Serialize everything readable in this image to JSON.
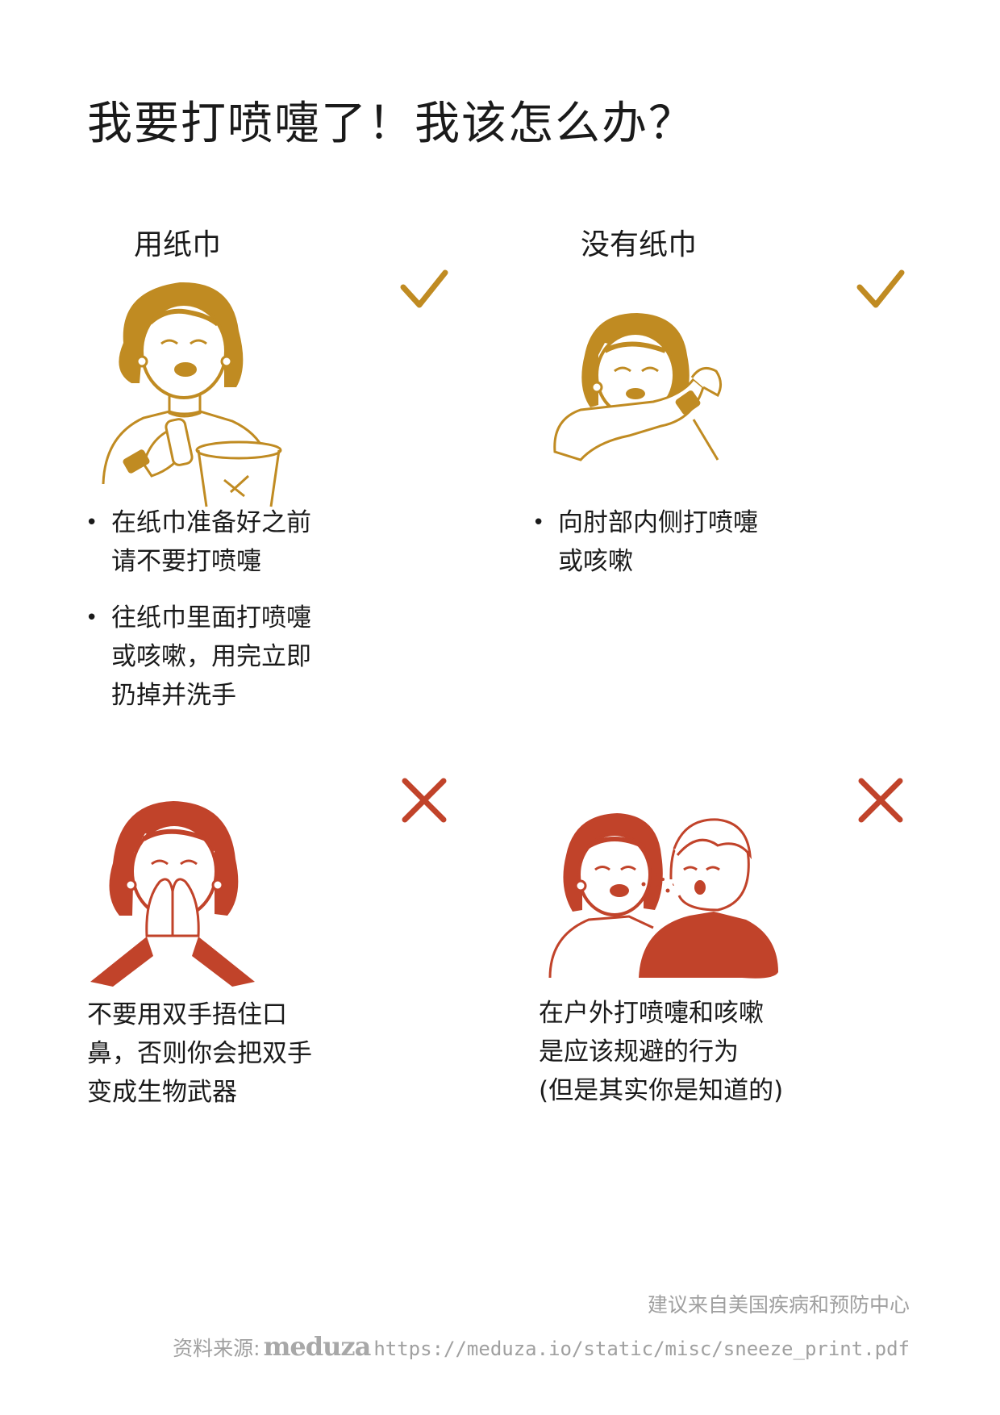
{
  "title": "我要打喷嚏了！我该怎么办？",
  "colors": {
    "gold": "#c08b22",
    "red": "#c1432a",
    "text": "#1a1a1a",
    "footer": "#a0a0a0"
  },
  "panels": {
    "tissue": {
      "heading": "用纸巾",
      "verdict_icon": "check-icon",
      "bullets": [
        "在纸巾准备好之前请不要打喷嚏",
        "往纸巾里面打喷嚏或咳嗽，用完立即扔掉并洗手"
      ]
    },
    "no_tissue": {
      "heading": "没有纸巾",
      "verdict_icon": "check-icon",
      "bullets": [
        "向肘部内侧打喷嚏或咳嗽"
      ]
    },
    "hands": {
      "verdict_icon": "cross-icon",
      "text": "不要用双手捂住口鼻，否则你会把双手变成生物武器"
    },
    "outdoor": {
      "verdict_icon": "cross-icon",
      "text_lines": [
        "在户外打喷嚏和咳嗽",
        "是应该规避的行为",
        "(但是其实你是知道的)"
      ]
    }
  },
  "footer": {
    "cdc": "建议来自美国疾病和预防中心",
    "source_label": "资料来源:",
    "logo": "meduza",
    "url": "https://meduza.io/static/misc/sneeze_print.pdf"
  }
}
